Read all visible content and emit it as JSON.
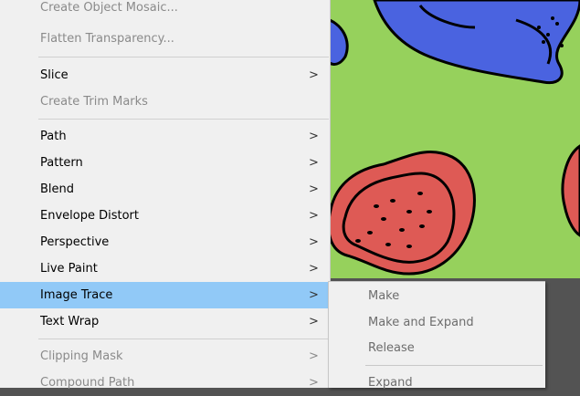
{
  "object_menu": {
    "items": [
      {
        "label": "Create Object Mosaic...",
        "submenu": false,
        "disabled": true
      },
      {
        "label": "Flatten Transparency...",
        "submenu": false,
        "disabled": true
      },
      {
        "label": "Slice",
        "submenu": true,
        "disabled": false
      },
      {
        "label": "Create Trim Marks",
        "submenu": false,
        "disabled": true
      },
      {
        "label": "Path",
        "submenu": true,
        "disabled": false
      },
      {
        "label": "Pattern",
        "submenu": true,
        "disabled": false
      },
      {
        "label": "Blend",
        "submenu": true,
        "disabled": false
      },
      {
        "label": "Envelope Distort",
        "submenu": true,
        "disabled": false
      },
      {
        "label": "Perspective",
        "submenu": true,
        "disabled": false
      },
      {
        "label": "Live Paint",
        "submenu": true,
        "disabled": false
      },
      {
        "label": "Image Trace",
        "submenu": true,
        "disabled": false,
        "highlighted": true
      },
      {
        "label": "Text Wrap",
        "submenu": true,
        "disabled": false
      },
      {
        "label": "Clipping Mask",
        "submenu": true,
        "disabled": true
      },
      {
        "label": "Compound Path",
        "submenu": true,
        "disabled": true
      }
    ],
    "submenu_arrow": ">"
  },
  "image_trace_submenu": {
    "items": [
      {
        "label": "Make"
      },
      {
        "label": "Make and Expand"
      },
      {
        "label": "Release"
      },
      {
        "label": "Expand"
      }
    ]
  },
  "canvas": {
    "background_color": "#96d15c",
    "shape_colors": {
      "blue": "#4a63e0",
      "red": "#de5a55",
      "outline": "#000000"
    }
  }
}
